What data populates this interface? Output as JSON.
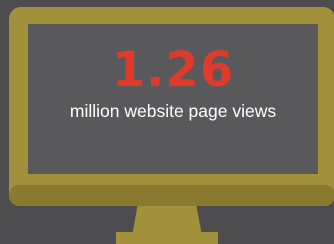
{
  "colors": {
    "background": "#4d4d4f",
    "monitor_frame": "#a3903a",
    "monitor_frame_shadow": "#8a7a30",
    "screen": "#59595b",
    "stat_value": "#e03a2a",
    "caption_text": "#ffffff"
  },
  "illustration": "desktop-monitor-icon",
  "stat": {
    "value": "1.26",
    "caption": "million website page views"
  }
}
